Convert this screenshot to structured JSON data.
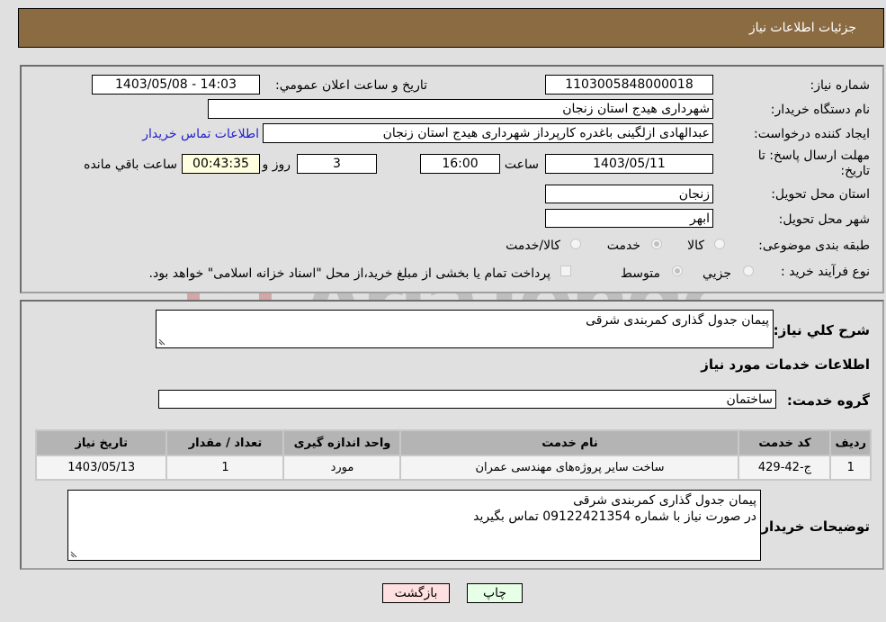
{
  "header": {
    "title": "جزئیات اطلاعات نیاز"
  },
  "form": {
    "need_number": {
      "label": "شماره نیاز:",
      "value": "1103005848000018"
    },
    "announce_datetime": {
      "label": "تاریخ و ساعت اعلان عمومي:",
      "value": "1403/05/08 - 14:03"
    },
    "buyer_org": {
      "label": "نام دستگاه خریدار:",
      "value": "شهرداری هیدج استان زنجان"
    },
    "requester": {
      "label": "ایجاد کننده درخواست:",
      "value": "عبدالهادی ازلگینی باغدره کارپرداز شهرداری هیدج استان زنجان"
    },
    "buyer_contact_link": "اطلاعات تماس خریدار",
    "deadline": {
      "label": "مهلت ارسال پاسخ: تا تاریخ:",
      "date": "1403/05/11",
      "time_label": "ساعت",
      "time": "16:00",
      "days": "3",
      "days_label": "روز و",
      "remaining": "00:43:35",
      "remaining_label": "ساعت باقي مانده"
    },
    "province": {
      "label": "استان محل تحویل:",
      "value": "زنجان"
    },
    "city": {
      "label": "شهر محل تحویل:",
      "value": "ابهر"
    },
    "category": {
      "label": "طبقه بندی موضوعی:",
      "options": [
        {
          "label": "کالا",
          "checked": false
        },
        {
          "label": "خدمت",
          "checked": true
        },
        {
          "label": "کالا/خدمت",
          "checked": false
        }
      ]
    },
    "purchase_type": {
      "label": "نوع فرآیند خرید :",
      "options": [
        {
          "label": "جزيي",
          "checked": false
        },
        {
          "label": "متوسط",
          "checked": true
        }
      ],
      "treasury_note": "پرداخت تمام یا بخشی از مبلغ خرید،از محل \"اسناد خزانه اسلامی\" خواهد بود."
    }
  },
  "details": {
    "general_desc": {
      "label": "شرح کلي نیاز:",
      "value": "پیمان جدول گذاری کمربندی شرقی"
    },
    "services_heading": "اطلاعات خدمات مورد نیاز",
    "service_group": {
      "label": "گروه خدمت:",
      "value": "ساختمان"
    },
    "table": {
      "headers": [
        "ردیف",
        "کد خدمت",
        "نام خدمت",
        "واحد اندازه گیری",
        "تعداد / مقدار",
        "تاریخ نیاز"
      ],
      "rows": [
        [
          "1",
          "ج-42-429",
          "ساخت سایر پروژه‌های مهندسی عمران",
          "مورد",
          "1",
          "1403/05/13"
        ]
      ]
    },
    "buyer_notes": {
      "label": "توضیحات خریدار:",
      "lines": [
        "پیمان جدول گذاری کمربندی شرقی",
        "در صورت نیاز با شماره 09122421354 تماس بگیرید"
      ]
    }
  },
  "buttons": {
    "print": "چاپ",
    "back": "بازگشت"
  },
  "watermark": {
    "text": "AriaTender.neT"
  }
}
